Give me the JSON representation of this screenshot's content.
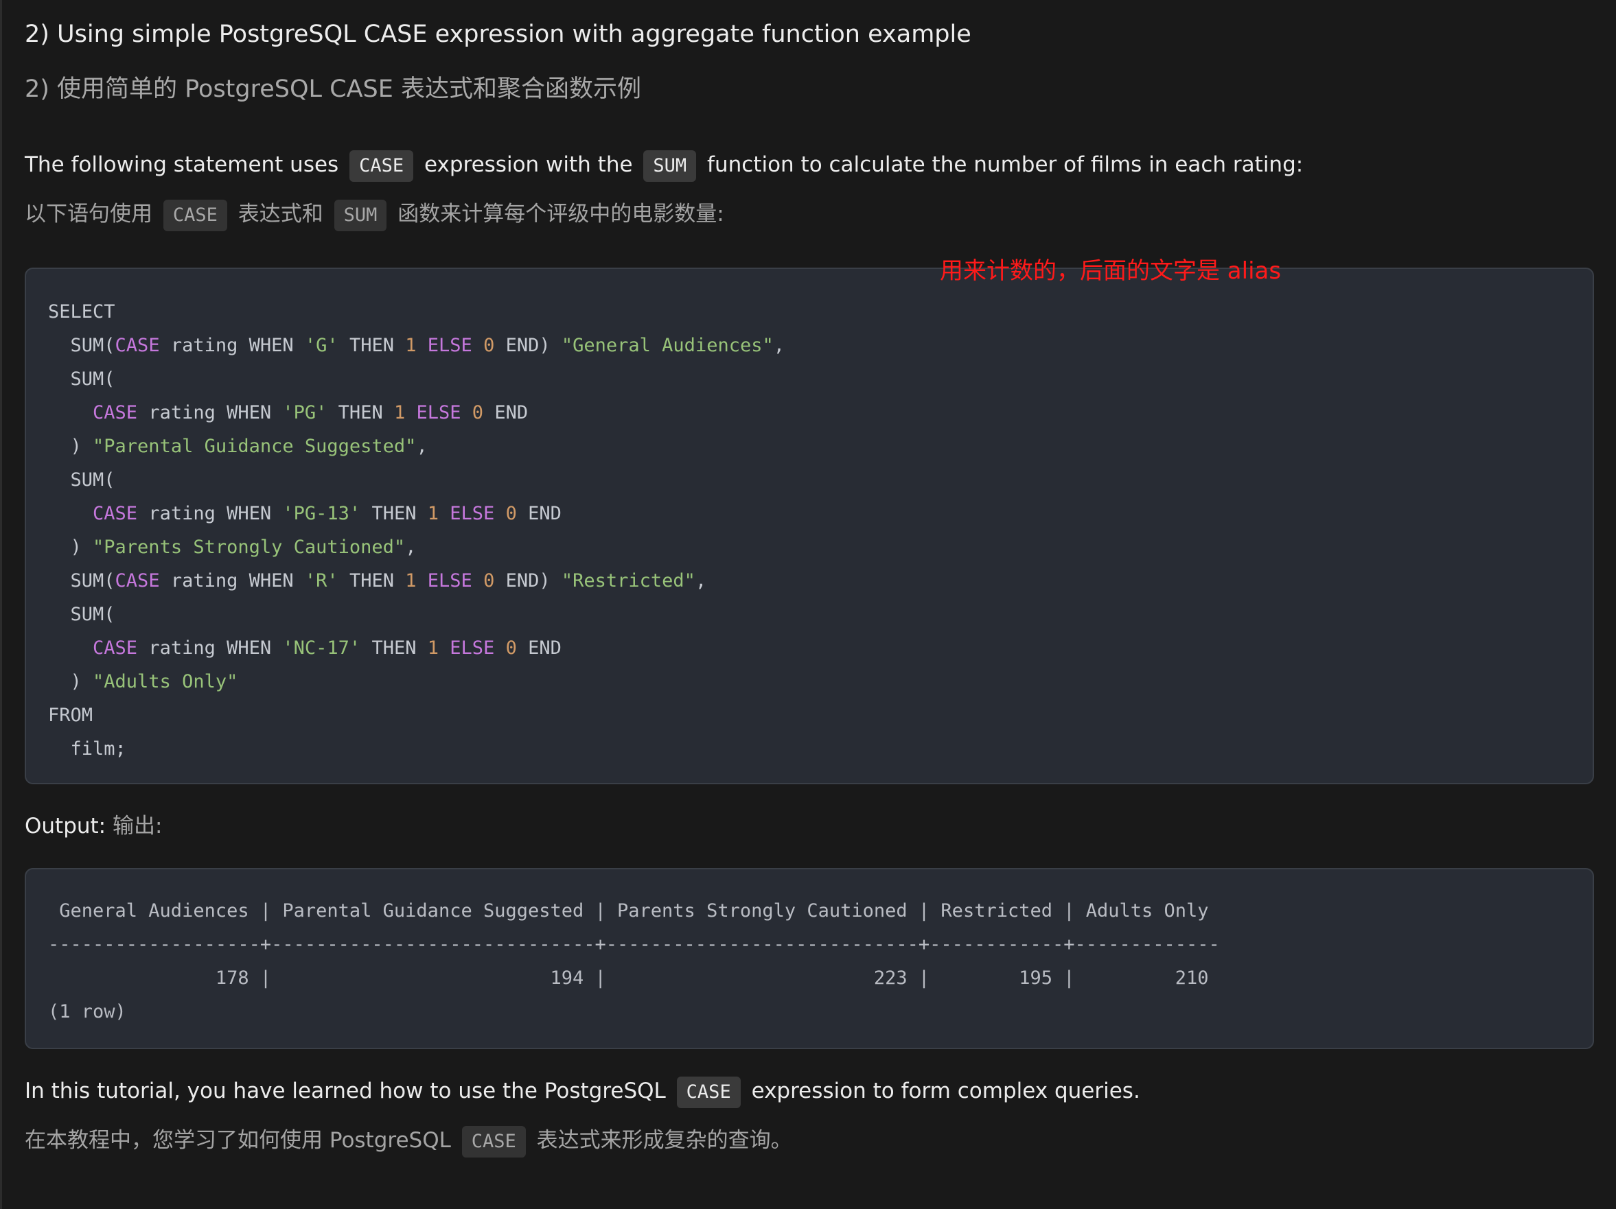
{
  "heading": {
    "en": "2) Using simple PostgreSQL CASE expression with aggregate function example",
    "zh": "2) 使用简单的 PostgreSQL CASE 表达式和聚合函数示例"
  },
  "intro": {
    "en_1": "The following statement uses",
    "en_code_1": "CASE",
    "en_2": "expression with the",
    "en_code_2": "SUM",
    "en_3": "function to calculate the number of films in each rating:",
    "zh_1": "以下语句使用",
    "zh_code_1": "CASE",
    "zh_2": "表达式和",
    "zh_code_2": "SUM",
    "zh_3": "函数来计算每个评级中的电影数量:"
  },
  "annotation": "用来计数的，后面的文字是 alias",
  "sql_code": "SELECT\n  SUM(CASE rating WHEN 'G' THEN 1 ELSE 0 END) \"General Audiences\",\n  SUM(\n    CASE rating WHEN 'PG' THEN 1 ELSE 0 END\n  ) \"Parental Guidance Suggested\",\n  SUM(\n    CASE rating WHEN 'PG-13' THEN 1 ELSE 0 END\n  ) \"Parents Strongly Cautioned\",\n  SUM(CASE rating WHEN 'R' THEN 1 ELSE 0 END) \"Restricted\",\n  SUM(\n    CASE rating WHEN 'NC-17' THEN 1 ELSE 0 END\n  ) \"Adults Only\"\nFROM\n  film;",
  "output_label": {
    "en": "Output:",
    "zh": "输出:"
  },
  "output_table": {
    "columns": [
      "General Audiences",
      "Parental Guidance Suggested",
      "Parents Strongly Cautioned",
      "Restricted",
      "Adults Only"
    ],
    "values": [
      "178",
      "194",
      "223",
      "195",
      "210"
    ],
    "row_count": "(1 row)"
  },
  "conclusion": {
    "en_1": "In this tutorial, you have learned how to use the PostgreSQL",
    "en_code": "CASE",
    "en_2": "expression to form complex queries.",
    "zh_1": "在本教程中，您学习了如何使用 PostgreSQL",
    "zh_code": "CASE",
    "zh_2": "表达式来形成复杂的查询。"
  },
  "colors": {
    "background": "#191919",
    "code_background": "#282c34",
    "keyword": "#c678dd",
    "string": "#98c379",
    "number": "#d19a66",
    "annotation": "#ff1a1a"
  }
}
